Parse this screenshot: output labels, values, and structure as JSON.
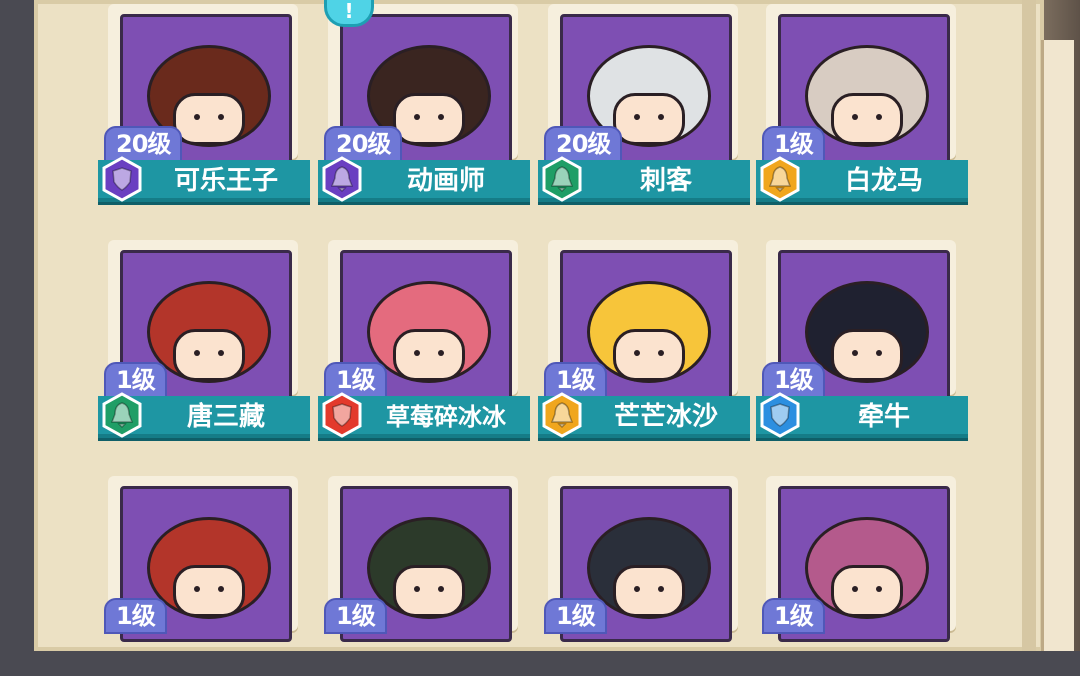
{
  "notification": {
    "mark": "!"
  },
  "colors": {
    "board": "#ece1c4",
    "portrait_bg": "#7e4fb3",
    "level_badge": "#6f78d6",
    "name_bar": "#1e96a3"
  },
  "characters": [
    {
      "level": "20级",
      "name": "可乐王子",
      "role_icon": "shield-icon",
      "icon_color": "#6a3fc1",
      "hair": "#6a2a1c"
    },
    {
      "level": "20级",
      "name": "动画师",
      "role_icon": "bell-icon",
      "icon_color": "#6a3fc1",
      "hair": "#3a2520"
    },
    {
      "level": "20级",
      "name": "刺客",
      "role_icon": "bell-icon",
      "icon_color": "#1f9e66",
      "hair": "#dfe2e4"
    },
    {
      "level": "1级",
      "name": "白龙马",
      "role_icon": "bell-icon",
      "icon_color": "#f0a61d",
      "hair": "#d8ccc2"
    },
    {
      "level": "1级",
      "name": "唐三藏",
      "role_icon": "bell-icon",
      "icon_color": "#1f9e66",
      "hair": "#b3352a"
    },
    {
      "level": "1级",
      "name": "草莓碎冰冰",
      "role_icon": "shield-icon",
      "icon_color": "#e33a2c",
      "hair": "#e46b7e"
    },
    {
      "level": "1级",
      "name": "芒芒冰沙",
      "role_icon": "bell-icon",
      "icon_color": "#f0a61d",
      "hair": "#f7c53a"
    },
    {
      "level": "1级",
      "name": "牵牛",
      "role_icon": "shield-icon",
      "icon_color": "#2c8fe0",
      "hair": "#1f2130"
    },
    {
      "level": "1级",
      "name": "",
      "role_icon": "",
      "icon_color": "",
      "hair": "#b3352a"
    },
    {
      "level": "1级",
      "name": "",
      "role_icon": "",
      "icon_color": "",
      "hair": "#2c3a2a"
    },
    {
      "level": "1级",
      "name": "",
      "role_icon": "",
      "icon_color": "",
      "hair": "#2a2f3a"
    },
    {
      "level": "1级",
      "name": "",
      "role_icon": "",
      "icon_color": "",
      "hair": "#b45a8c"
    }
  ]
}
